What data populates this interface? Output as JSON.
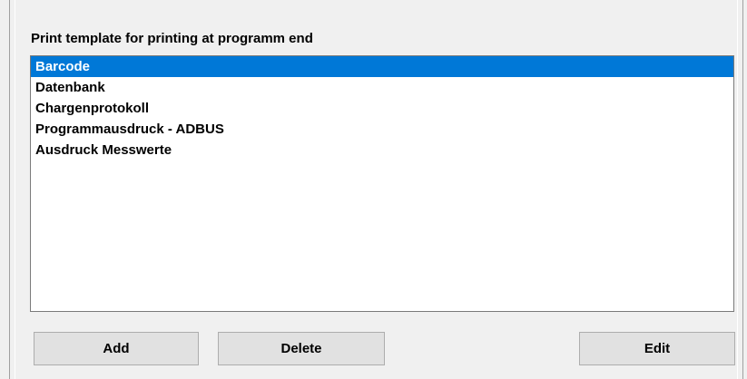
{
  "group": {
    "label": "Print template for printing at programm end"
  },
  "list": {
    "items": [
      {
        "label": "Barcode",
        "selected": true
      },
      {
        "label": "Datenbank",
        "selected": false
      },
      {
        "label": "Chargenprotokoll",
        "selected": false
      },
      {
        "label": "Programmausdruck - ADBUS",
        "selected": false
      },
      {
        "label": "Ausdruck Messwerte",
        "selected": false
      }
    ]
  },
  "buttons": {
    "add_label": "Add",
    "delete_label": "Delete",
    "edit_label": "Edit"
  },
  "colors": {
    "selection": "#0078d7",
    "background": "#f0f0f0"
  }
}
